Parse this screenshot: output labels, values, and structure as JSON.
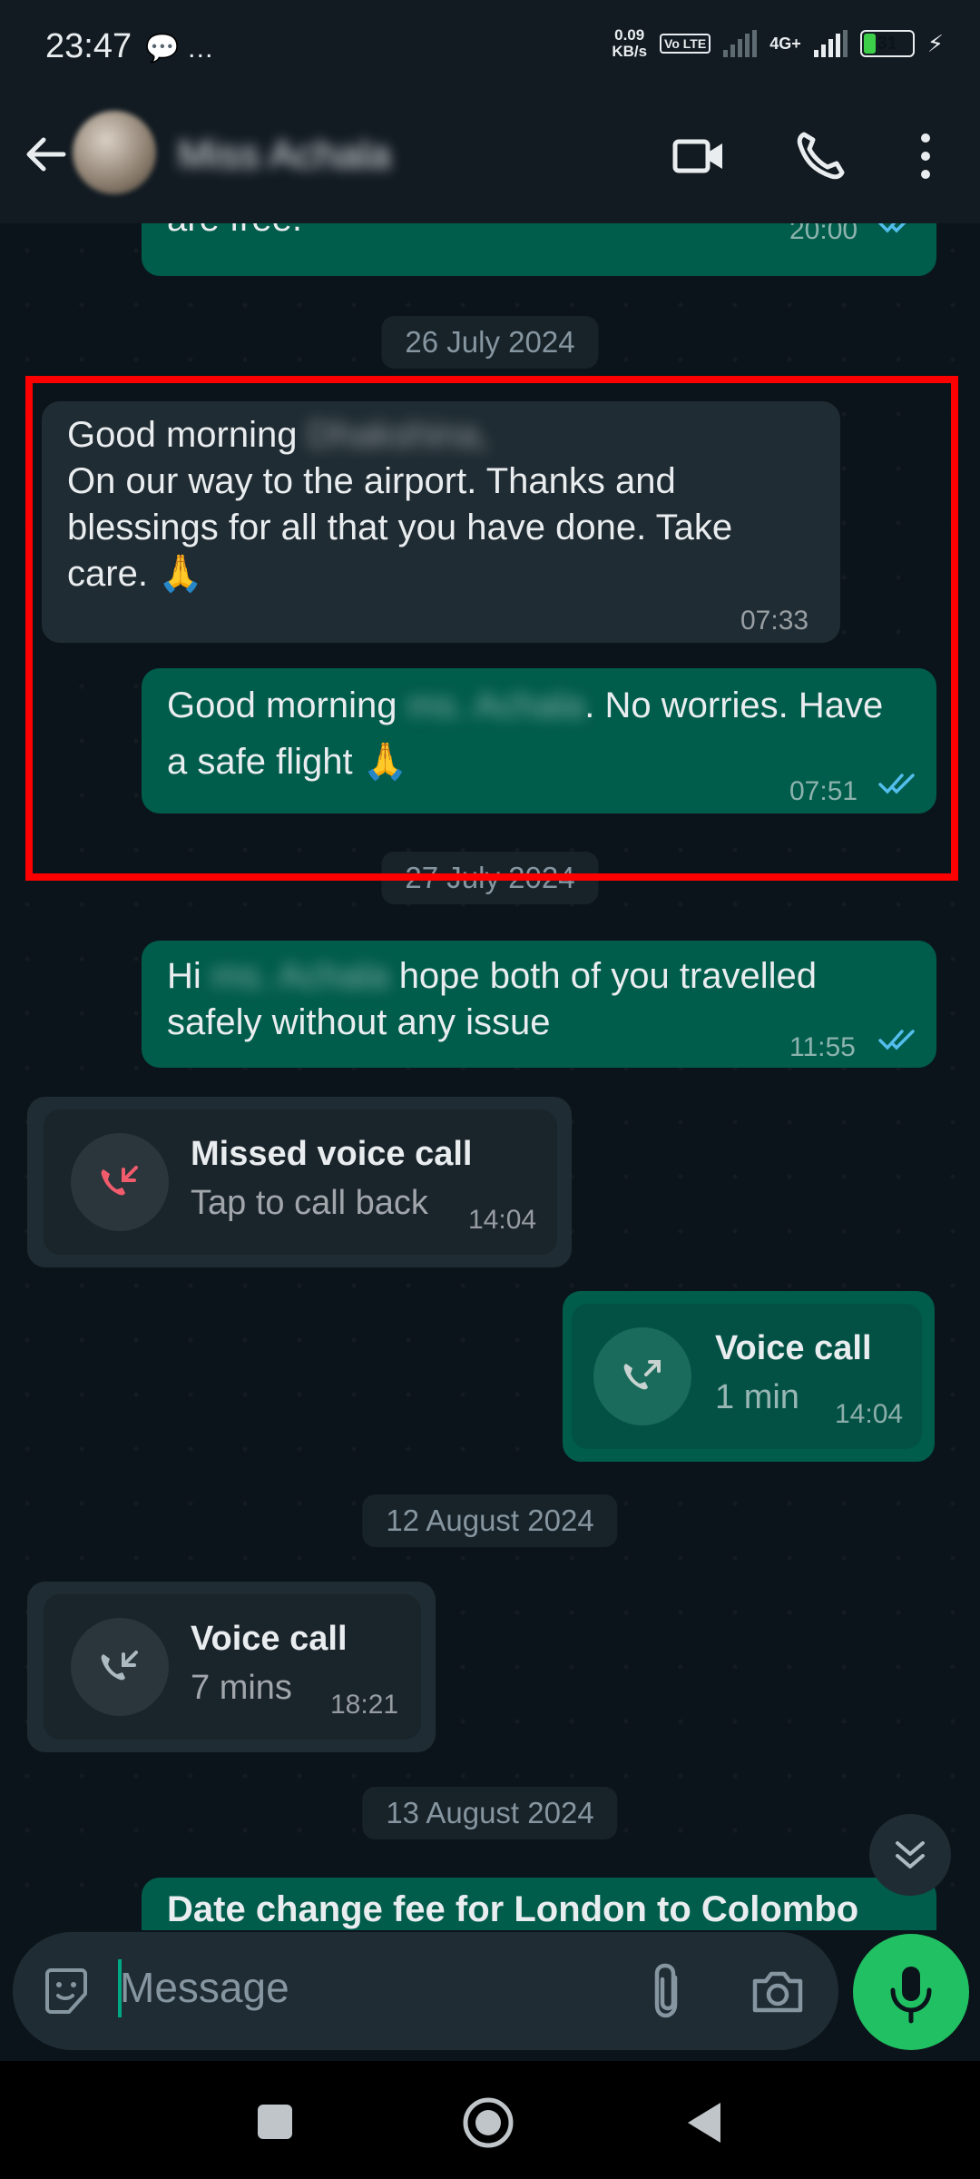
{
  "status_bar": {
    "time": "23:47",
    "left_icons": "💬 …",
    "net_speed_value": "0.09",
    "net_speed_unit": "KB/s",
    "volte": "Vo LTE",
    "network": "4G+",
    "battery": "31",
    "battery_level": 0.31
  },
  "header": {
    "contact_name": "Miss Achala",
    "icons": [
      "back-arrow-icon",
      "video-call-icon",
      "voice-call-icon",
      "more-options-icon"
    ]
  },
  "messages": {
    "m0": {
      "text": "are free.",
      "time": "20:00"
    },
    "date1": "26 July 2024",
    "m1": {
      "greeting": "Good morning",
      "greeting_name": "Dhakshina,",
      "body": "On our way to the airport. Thanks and blessings for all that you have done. Take care. 🙏",
      "time": "07:33"
    },
    "m2": {
      "pre": "Good morning",
      "name": "ms. Achala",
      "post": ". No worries. Have a safe flight 🙏",
      "time": "07:51"
    },
    "date2": "27 July 2024",
    "m3": {
      "pre": "Hi",
      "name": "ms. Achala",
      "post": "hope both of you travelled safely without any issue",
      "time": "11:55"
    },
    "call1": {
      "title": "Missed voice call",
      "sub": "Tap to call back",
      "time": "14:04"
    },
    "call2": {
      "title": "Voice call",
      "sub": "1 min",
      "time": "14:04"
    },
    "date3": "12 August 2024",
    "call3": {
      "title": "Voice call",
      "sub": "7 mins",
      "time": "18:21"
    },
    "date4": "13 August 2024",
    "m4": {
      "text": "Date change fee for London to Colombo"
    }
  },
  "composer": {
    "placeholder": "Message",
    "icons": [
      "sticker-icon",
      "attach-icon",
      "camera-icon",
      "mic-icon"
    ]
  },
  "colors": {
    "incoming": "#202c33",
    "outgoing": "#005c4b",
    "read_ticks": "#53bdeb",
    "missed_call": "#f15c6d",
    "mic_button": "#21c063",
    "highlight": "#ff0000"
  }
}
